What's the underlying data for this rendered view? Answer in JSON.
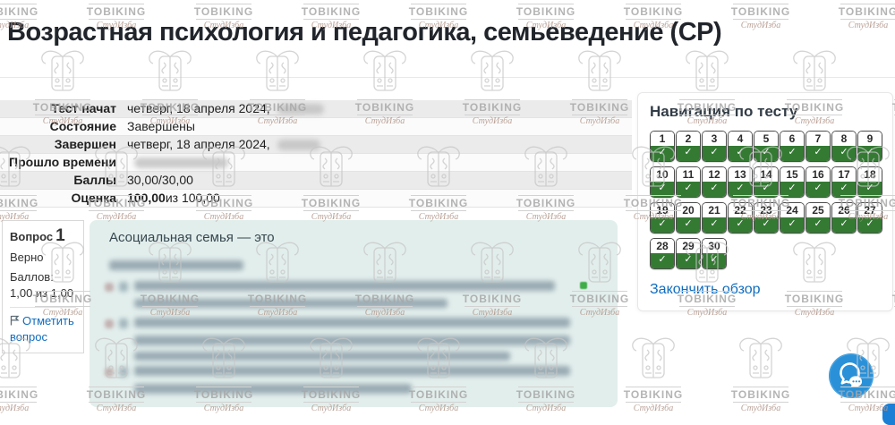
{
  "title": "Возрастная психология и педагогика, семьеведение (СР)",
  "watermark": {
    "brand": "TOBIKING",
    "site": "СтудИзба"
  },
  "summary": {
    "rows": [
      {
        "label": "Тест начат",
        "value": "четверг, 18 апреля 2024,",
        "redacted": true,
        "redact_w": 52
      },
      {
        "label": "Состояние",
        "value": "Завершены",
        "redacted": false
      },
      {
        "label": "Завершен",
        "value": "четверг, 18 апреля 2024,",
        "redacted": true,
        "redact_w": 48
      },
      {
        "label": "Прошло времени",
        "value": "",
        "redacted": true,
        "redact_w": 105
      },
      {
        "label": "Баллы",
        "value": "30,00/30,00",
        "redacted": false
      },
      {
        "label": "Оценка",
        "value_bold": "100,00",
        "value": " из 100,00",
        "redacted": false
      }
    ]
  },
  "question_panel": {
    "label": "Вопрос",
    "number": "1",
    "status": "Верно",
    "points": "Баллов: 1,00 из 1,00",
    "flag_label": "Отметить вопрос"
  },
  "question": {
    "text": "Асоциальная семья — это"
  },
  "quiz_nav": {
    "title": "Навигация по тесту",
    "finish_label": "Закончить обзор",
    "questions": [
      {
        "n": "1",
        "state": "correct"
      },
      {
        "n": "2",
        "state": "correct"
      },
      {
        "n": "3",
        "state": "correct"
      },
      {
        "n": "4",
        "state": "correct"
      },
      {
        "n": "5",
        "state": "correct"
      },
      {
        "n": "6",
        "state": "correct"
      },
      {
        "n": "7",
        "state": "correct"
      },
      {
        "n": "8",
        "state": "correct"
      },
      {
        "n": "9",
        "state": "correct"
      },
      {
        "n": "10",
        "state": "correct"
      },
      {
        "n": "11",
        "state": "correct"
      },
      {
        "n": "12",
        "state": "correct"
      },
      {
        "n": "13",
        "state": "correct"
      },
      {
        "n": "14",
        "state": "correct"
      },
      {
        "n": "15",
        "state": "correct"
      },
      {
        "n": "16",
        "state": "correct"
      },
      {
        "n": "17",
        "state": "correct"
      },
      {
        "n": "18",
        "state": "correct"
      },
      {
        "n": "19",
        "state": "correct"
      },
      {
        "n": "20",
        "state": "correct"
      },
      {
        "n": "21",
        "state": "correct"
      },
      {
        "n": "22",
        "state": "correct"
      },
      {
        "n": "23",
        "state": "correct"
      },
      {
        "n": "24",
        "state": "correct"
      },
      {
        "n": "25",
        "state": "correct"
      },
      {
        "n": "26",
        "state": "correct"
      },
      {
        "n": "27",
        "state": "correct"
      },
      {
        "n": "28",
        "state": "correct"
      },
      {
        "n": "29",
        "state": "correct"
      },
      {
        "n": "30",
        "state": "correct"
      }
    ]
  },
  "icons": {
    "check": "✓",
    "nav_button_check": "check-icon",
    "flag": "flag-icon",
    "chat": "chat-bubbles-icon",
    "crest": "studizba-crest-icon"
  },
  "colors": {
    "correct_green": "#347a33",
    "link_blue": "#0f6cbf",
    "question_bg_teal": "#e2eeec",
    "title_dark": "#21252b",
    "chat_blue": "#2a91d8"
  }
}
